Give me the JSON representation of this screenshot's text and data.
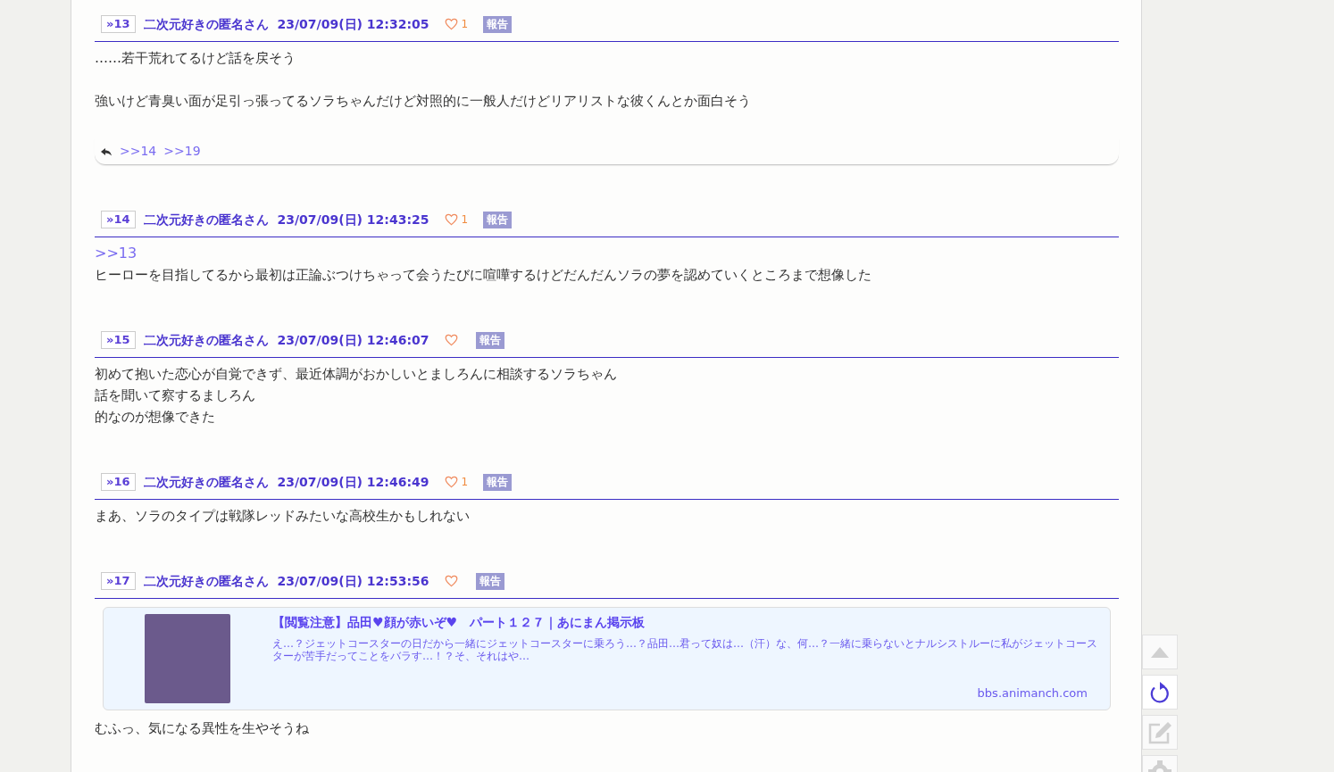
{
  "posts": [
    {
      "number": "»13",
      "author": "二次元好きの匿名さん",
      "date": "23/07/09(日) 12:32:05",
      "likes": "1",
      "report": "報告",
      "paragraphs": [
        [
          "……若干荒れてるけど話を戻そう"
        ],
        [
          "強いけど青臭い面が足引っ張ってるソラちゃんだけど対照的に一般人だけどリアリストな彼くんとか面白そう"
        ]
      ],
      "replies": [
        ">>14",
        ">>19"
      ]
    },
    {
      "number": "»14",
      "author": "二次元好きの匿名さん",
      "date": "23/07/09(日) 12:43:25",
      "likes": "1",
      "report": "報告",
      "anchor": ">>13",
      "paragraphs": [
        [
          "ヒーローを目指してるから最初は正論ぶつけちゃって会うたびに喧嘩するけどだんだんソラの夢を認めていくところまで想像した"
        ]
      ]
    },
    {
      "number": "»15",
      "author": "二次元好きの匿名さん",
      "date": "23/07/09(日) 12:46:07",
      "report": "報告",
      "paragraphs": [
        [
          "初めて抱いた恋心が自覚できず、最近体調がおかしいとましろんに相談するソラちゃん",
          "話を聞いて察するましろん",
          "的なのが想像できた"
        ]
      ]
    },
    {
      "number": "»16",
      "author": "二次元好きの匿名さん",
      "date": "23/07/09(日) 12:46:49",
      "likes": "1",
      "report": "報告",
      "paragraphs": [
        [
          "まあ、ソラのタイプは戦隊レッドみたいな高校生かもしれない"
        ]
      ]
    },
    {
      "number": "»17",
      "author": "二次元好きの匿名さん",
      "date": "23/07/09(日) 12:53:56",
      "report": "報告",
      "link_card": {
        "title": "【閲覧注意】品田♥顔が赤いぞ♥　パート１２７｜あにまん掲示板",
        "description": "え…？ジェットコースターの日だから一緒にジェットコースターに乗ろう…？品田…君って奴は…（汗）な、何…？一緒に乗らないとナルシストルーに私がジェットコースターが苦手だってことをバラす…！？そ、それはや…",
        "domain": "bbs.animanch.com"
      },
      "paragraphs": [
        [
          "むふっ、気になる異性を生やそうね"
        ]
      ]
    }
  ]
}
